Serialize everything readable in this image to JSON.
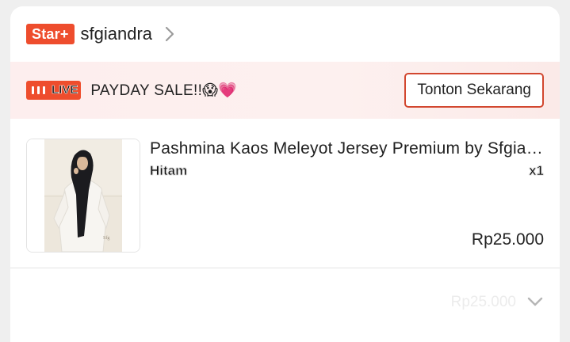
{
  "shop": {
    "badge": "Star+",
    "name": "sfgiandra"
  },
  "live": {
    "badge_text": "LIVE",
    "title": "PAYDAY SALE!!😱💗",
    "watch_button": "Tonton Sekarang"
  },
  "product": {
    "name": "Pashmina Kaos Meleyot  Jersey Premium by Sfgiandra",
    "variant": "Hitam",
    "quantity": "x1",
    "price": "Rp25.000"
  },
  "footer": {
    "total_text": "Rp25.000"
  },
  "colors": {
    "accent": "#ee4d2d",
    "live_strip_bg": "#fdeeee",
    "button_border": "#d2472f"
  }
}
